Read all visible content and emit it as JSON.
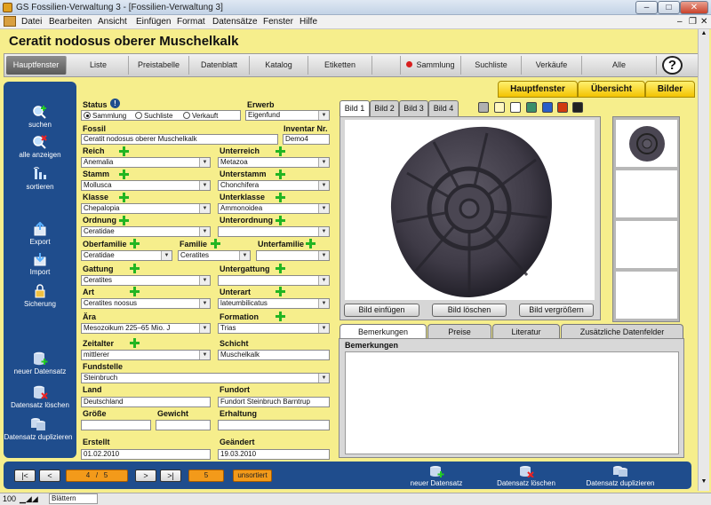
{
  "window": {
    "title": "GS Fossilien-Verwaltung 3 - [Fossilien-Verwaltung 3]",
    "btn_min": "–",
    "btn_max": "□",
    "btn_close": "✕"
  },
  "menu": [
    "Datei",
    "Bearbeiten",
    "Ansicht",
    "Einfügen",
    "Format",
    "Datensätze",
    "Fenster",
    "Hilfe"
  ],
  "header": {
    "title": "Ceratit nodosus oberer Muschelkalk"
  },
  "nav": [
    "Hauptfenster",
    "Liste",
    "Preistabelle",
    "Datenblatt",
    "Katalog",
    "Etiketten",
    "Sammlung",
    "Suchliste",
    "Verkäufe",
    "Alle"
  ],
  "help": "?",
  "right_tabs": [
    "Hauptfenster",
    "Übersicht",
    "Bilder"
  ],
  "sidebar": [
    "suchen",
    "alle anzeigen",
    "sortieren",
    "Export",
    "Import",
    "Sicherung",
    "neuer Datensatz",
    "Datensatz löschen",
    "Datensatz duplizieren"
  ],
  "form": {
    "status_label": "Status",
    "status_options": [
      "Sammlung",
      "Suchliste",
      "Verkauft"
    ],
    "erwerb_label": "Erwerb",
    "erwerb": "Eigenfund",
    "fossil_label": "Fossil",
    "fossil": "Ceratit nodosus oberer Muschelkalk",
    "inventar_label": "Inventar Nr.",
    "inventar": "Demo4",
    "reich_label": "Reich",
    "reich": "Anemalia",
    "unterreich_label": "Unterreich",
    "unterreich": "Metazoa",
    "stamm_label": "Stamm",
    "stamm": "Mollusca",
    "unterstamm_label": "Unterstamm",
    "unterstamm": "Chonchifera",
    "klasse_label": "Klasse",
    "klasse": "Chepalopia",
    "unterklasse_label": "Unterklasse",
    "unterklasse": "Ammonoidea",
    "ordnung_label": "Ordnung",
    "ordnung": "Ceratidae",
    "unterordnung_label": "Unterordnung",
    "unterordnung": "",
    "oberfamilie_label": "Oberfamilie",
    "oberfamilie": "Ceratidae",
    "familie_label": "Familie",
    "familie": "Ceratites",
    "unterfamilie_label": "Unterfamilie",
    "unterfamilie": "",
    "gattung_label": "Gattung",
    "gattung": "Ceratites",
    "untergattung_label": "Untergattung",
    "untergattung": "",
    "art_label": "Art",
    "art": "Ceratites noosus",
    "unterart_label": "Unterart",
    "unterart": "lateumbilicatus",
    "aera_label": "Ära",
    "aera": "Mesozoikum 225–65 Mio. J",
    "formation_label": "Formation",
    "formation": "Trias",
    "zeitalter_label": "Zeitalter",
    "zeitalter": "mittlerer",
    "schicht_label": "Schicht",
    "schicht": "Muschelkalk",
    "fundstelle_label": "Fundstelle",
    "fundstelle": "Steinbruch",
    "land_label": "Land",
    "land": "Deutschland",
    "fundort_label": "Fundort",
    "fundort": "Fundort  Steinbruch Barntrup",
    "groesse_label": "Größe",
    "groesse": "",
    "gewicht_label": "Gewicht",
    "gewicht": "",
    "erhaltung_label": "Erhaltung",
    "erhaltung": "",
    "erstellt_label": "Erstellt",
    "erstellt": "01.02.2010",
    "geaendert_label": "Geändert",
    "geaendert": "19.03.2010"
  },
  "image_tabs": [
    "Bild 1",
    "Bild 2",
    "Bild 3",
    "Bild 4"
  ],
  "swatches": [
    "#b0b0b0",
    "#fff8c0",
    "#ffffff",
    "#3a8f6a",
    "#2a5fc8",
    "#d03a10",
    "#222222"
  ],
  "image_buttons": [
    "Bild einfügen",
    "Bild löschen",
    "Bild vergrößern"
  ],
  "bottom_tabs": [
    "Bemerkungen",
    "Preise",
    "Literatur",
    "Zusätzliche Datenfelder"
  ],
  "remarks_label": "Bemerkungen",
  "pager": {
    "first": "|<",
    "prev": "<",
    "current": "4",
    "sep": "/",
    "total": "5",
    "next": ">",
    "last": ">|",
    "count": "5",
    "sort": "unsortiert"
  },
  "bottom_actions": [
    "neuer Datensatz",
    "Datensatz löschen",
    "Datensatz duplizieren"
  ],
  "statusbar": {
    "zoom": "100",
    "sheet": "Blättern"
  }
}
